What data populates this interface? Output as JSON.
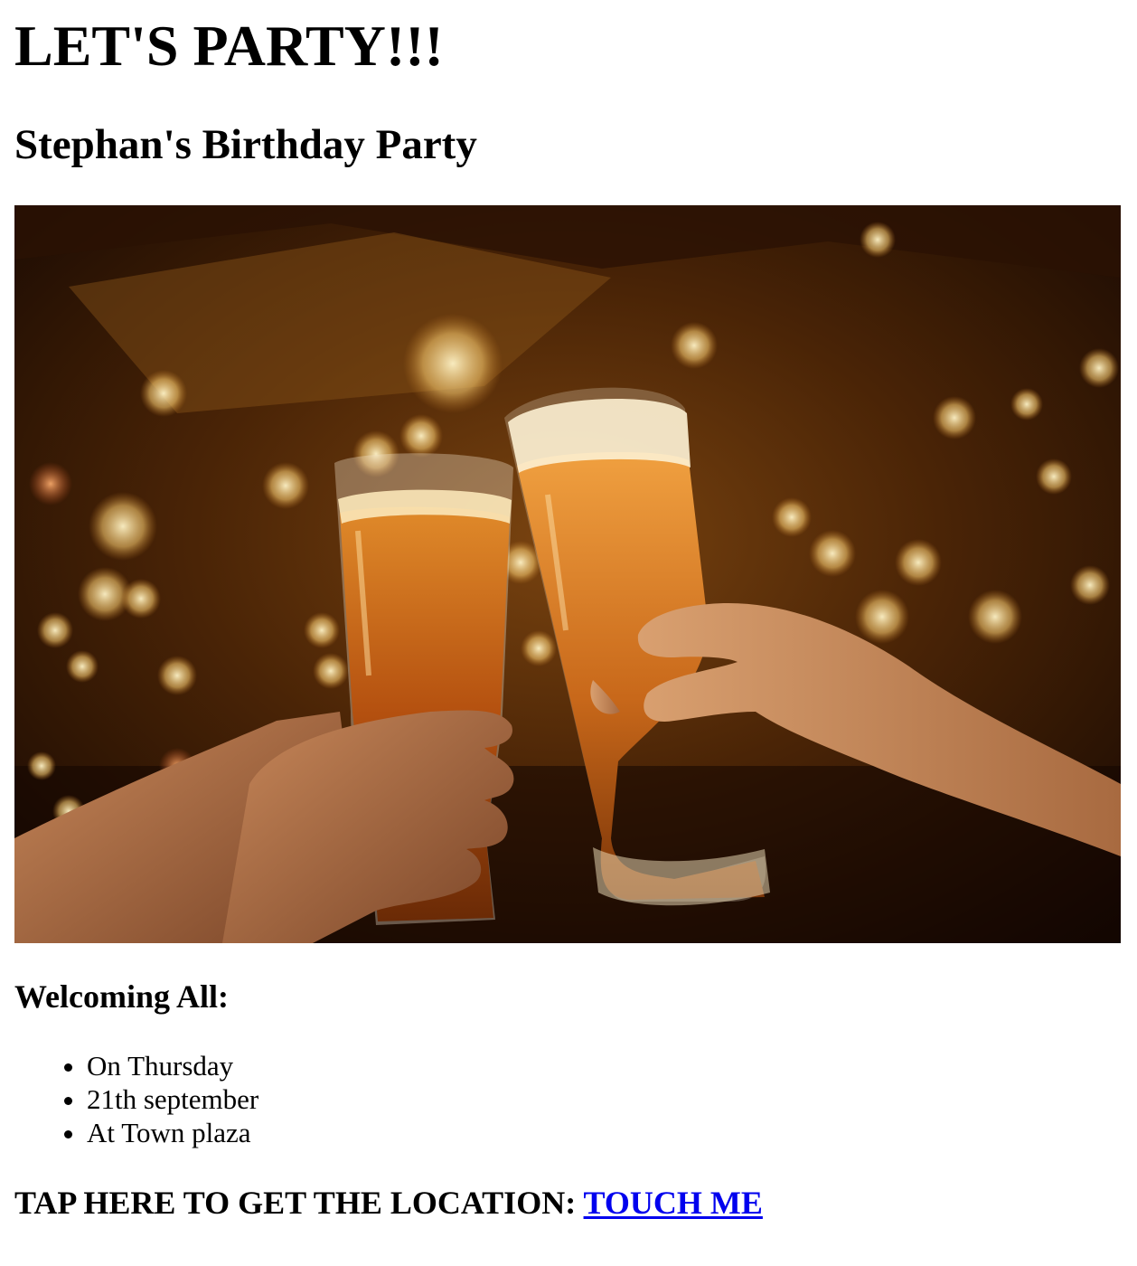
{
  "header": {
    "title": "LET'S PARTY!!!",
    "subtitle": "Stephan's Birthday Party"
  },
  "welcome": {
    "heading": "Welcoming All:",
    "items": [
      "On Thursday",
      "21th september",
      "At Town plaza"
    ]
  },
  "location": {
    "prompt": "TAP HERE TO GET THE LOCATION:",
    "link_label": "TOUCH ME"
  },
  "colors": {
    "link": "#0000ee",
    "text": "#000000",
    "background": "#ffffff"
  }
}
